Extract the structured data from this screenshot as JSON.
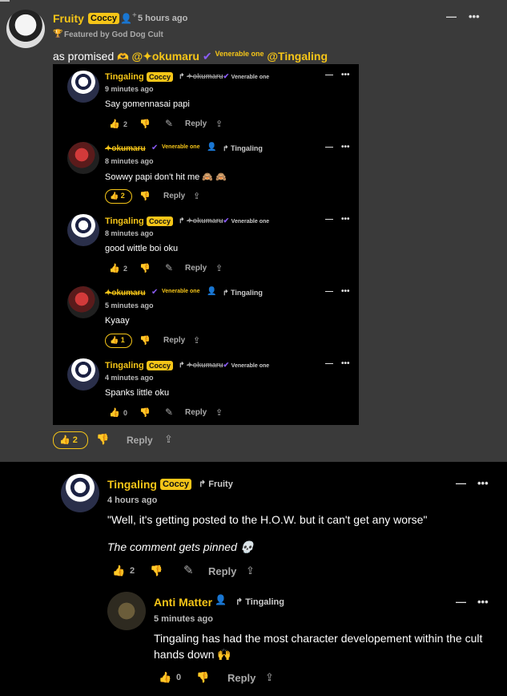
{
  "top_comment": {
    "username": "Fruity",
    "badge": "Coccy",
    "time": "5 hours ago",
    "featured": "Featured by God Dog Cult",
    "text_prefix": "as promised",
    "mention1": "@✦okumaru",
    "mention1_title": "Venerable one",
    "mention2": "@Tingaling",
    "likes": "2",
    "reply_label": "Reply"
  },
  "nested_replies": [
    {
      "user": "Tingaling",
      "badge": "Coccy",
      "reply_to": "✦okumaru",
      "reply_to_title": "Venerable one",
      "time": "9 minutes ago",
      "text": "Say gomennasai papi",
      "likes": "2",
      "reply": "Reply",
      "liked": false
    },
    {
      "user": "✦okumaru",
      "badge": "Venerable one",
      "reply_to": "Tingaling",
      "time": "8 minutes ago",
      "text": "Sowwy papi don't hit me 🙈 🙈",
      "likes": "2",
      "reply": "Reply",
      "liked": true
    },
    {
      "user": "Tingaling",
      "badge": "Coccy",
      "reply_to": "✦okumaru",
      "reply_to_title": "Venerable one",
      "time": "8 minutes ago",
      "text": "good wittle boi oku",
      "likes": "2",
      "reply": "Reply",
      "liked": false
    },
    {
      "user": "✦okumaru",
      "badge": "Venerable one",
      "reply_to": "Tingaling",
      "time": "5 minutes ago",
      "text": "Kyaay",
      "likes": "1",
      "reply": "Reply",
      "liked": true
    },
    {
      "user": "Tingaling",
      "badge": "Coccy",
      "reply_to": "✦okumaru",
      "reply_to_title": "Venerable one",
      "time": "4 minutes ago",
      "text": "Spanks little oku",
      "likes": "0",
      "reply": "Reply",
      "liked": false
    }
  ],
  "second_comment": {
    "username": "Tingaling",
    "badge": "Coccy",
    "reply_to": "Fruity",
    "time": "4 hours ago",
    "text1": "\"Well, it's getting posted to the H.O.W. but it can't get any worse\"",
    "text2": "The comment gets pinned 💀",
    "likes": "2",
    "reply_label": "Reply"
  },
  "third_comment": {
    "username": "Anti Matter",
    "reply_to": "Tingaling",
    "time": "5 minutes ago",
    "text1": "Tingaling has had the most character developement within the cult",
    "text2": "hands down 🙌",
    "likes": "0",
    "reply_label": "Reply"
  },
  "icons": {
    "menu_dash": "—",
    "menu_dots": "•••",
    "thumb_up": "👍",
    "thumb_down": "👎",
    "pencil": "✎",
    "share": "⇪",
    "reply_arrow": "↱",
    "trophy": "🏆",
    "add_user": "👤+"
  },
  "colors": {
    "accent": "#f5c518",
    "card": "#3a3a3a",
    "page": "#000000"
  }
}
